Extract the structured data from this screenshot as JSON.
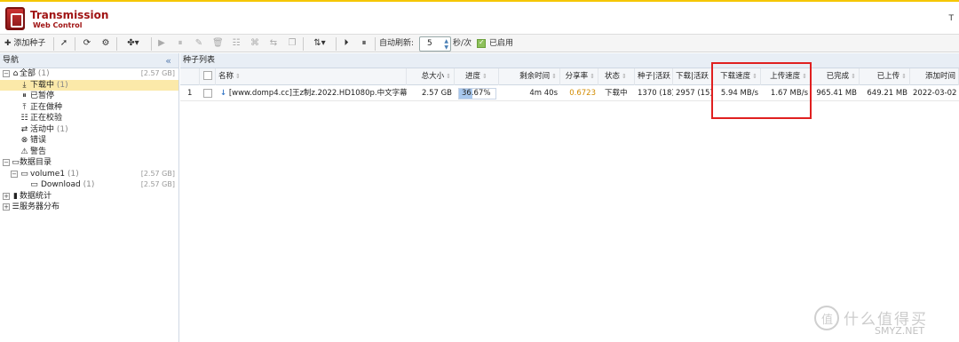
{
  "app": {
    "title": "Transmission",
    "subtitle": "Web Control",
    "header_right": "T"
  },
  "colors": {
    "brand": "#a01414",
    "selected_row": "#fbe9a9",
    "progress": "#a8c8ee",
    "highlight": "#e02020",
    "ratio": "#d28b00"
  },
  "toolbar": {
    "add_label": "添加种子",
    "auto_refresh_label": "自动刷新:",
    "refresh_value": "5",
    "refresh_unit": "秒/次",
    "enabled_label": "已启用"
  },
  "nav": {
    "title": "导航",
    "all": {
      "label": "全部",
      "count": "(1)",
      "size": "[2.57 GB]"
    },
    "status_items": [
      {
        "label": "下载中",
        "count": "(1)",
        "icon": "download-icon"
      },
      {
        "label": "已暂停",
        "count": "",
        "icon": "pause-icon"
      },
      {
        "label": "正在做种",
        "count": "",
        "icon": "seed-icon"
      },
      {
        "label": "正在校验",
        "count": "",
        "icon": "check-icon"
      },
      {
        "label": "活动中",
        "count": "(1)",
        "icon": "activity-icon"
      },
      {
        "label": "错误",
        "count": "",
        "icon": "error-icon"
      },
      {
        "label": "警告",
        "count": "",
        "icon": "warning-icon"
      }
    ],
    "data_dir": {
      "label": "数据目录"
    },
    "volume": {
      "label": "volume1",
      "count": "(1)",
      "size": "[2.57 GB]"
    },
    "download": {
      "label": "Download",
      "count": "(1)",
      "size": "[2.57 GB]"
    },
    "stats": {
      "label": "数据统计"
    },
    "servers": {
      "label": "服务器分布"
    }
  },
  "torrents": {
    "title": "种子列表",
    "columns": [
      "名称",
      "总大小",
      "进度",
      "剩余时间",
      "分享率",
      "状态",
      "种子|活跃",
      "下载|活跃",
      "下载速度",
      "上传速度",
      "已完成",
      "已上传",
      "添加时间"
    ],
    "rows": [
      {
        "index": "1",
        "name": "[www.domp4.cc]王z制z.2022.HD1080p.中文字幕.",
        "size": "2.57 GB",
        "progress_text": "36.67%",
        "progress": 0.3667,
        "remaining": "4m 40s",
        "ratio": "0.6723",
        "status": "下载中",
        "seeds": "1370 (18)",
        "peers": "2957 (15)",
        "down_speed": "5.94 MB/s",
        "up_speed": "1.67 MB/s",
        "completed": "965.41 MB",
        "uploaded": "649.21 MB",
        "added": "2022-03-02"
      }
    ]
  },
  "watermark": {
    "text": "什么值得买",
    "site": "SMYZ.NET"
  }
}
